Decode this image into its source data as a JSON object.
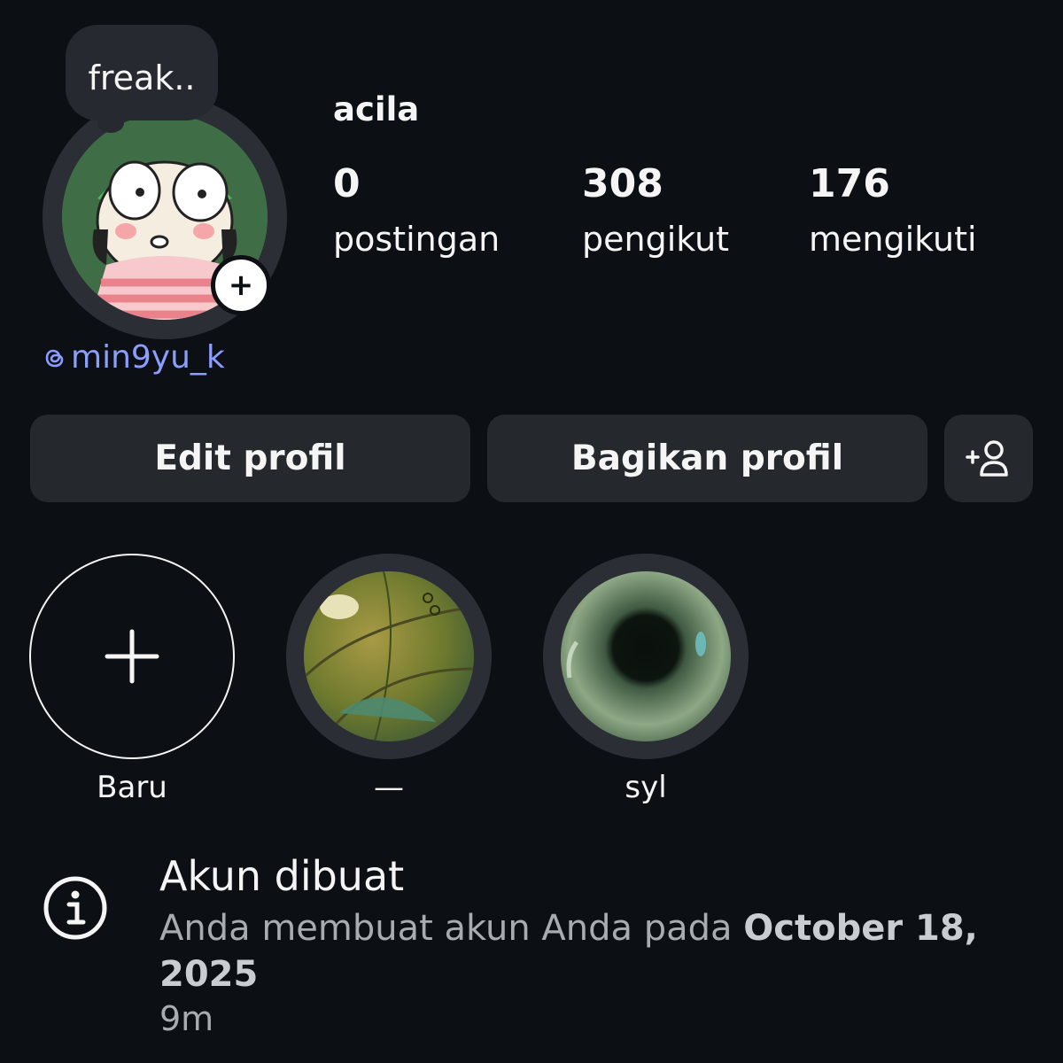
{
  "profile": {
    "note": "freak..",
    "username": "acila",
    "threads_handle": "min9yu_k",
    "stats": {
      "posts_count": "0",
      "posts_label": "postingan",
      "followers_count": "308",
      "followers_label": "pengikut",
      "following_count": "176",
      "following_label": "mengikuti"
    }
  },
  "actions": {
    "edit_label": "Edit profil",
    "share_label": "Bagikan profil",
    "discover_icon": "add-person-icon"
  },
  "highlights": [
    {
      "label": "Baru"
    },
    {
      "label": "—"
    },
    {
      "label": "syl"
    }
  ],
  "account_info": {
    "title": "Akun dibuat",
    "description": "Anda membuat akun Anda pada ",
    "date": "October 18, 2025",
    "time": "9m"
  },
  "colors": {
    "background": "#0c1014",
    "button": "#25292e",
    "link": "#8b9dfd"
  }
}
